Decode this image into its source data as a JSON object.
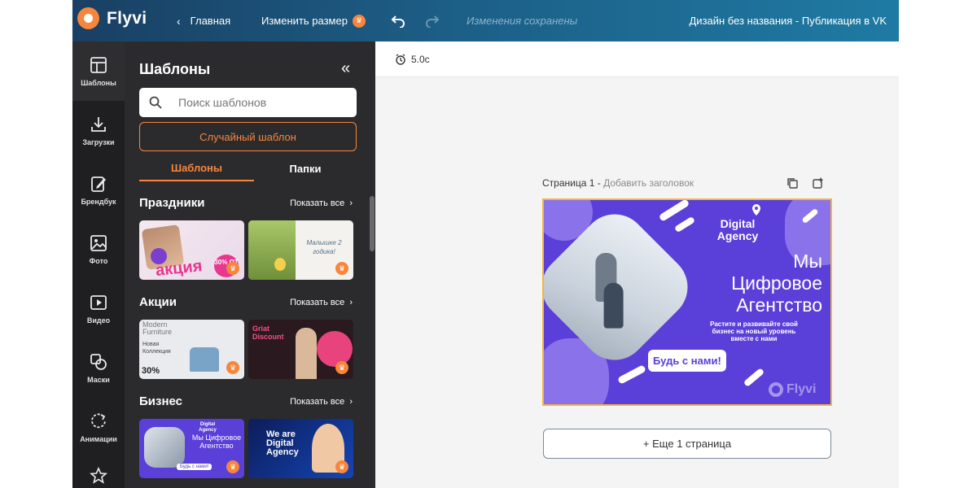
{
  "app": {
    "name": "Flyvi"
  },
  "topbar": {
    "home_label": "Главная",
    "resize_label": "Изменить размер",
    "save_status": "Изменения сохранены",
    "doc_title": "Дизайн без названия - Публикация в VK"
  },
  "rail": {
    "items": [
      {
        "label": "Шаблоны",
        "icon": "layout-icon"
      },
      {
        "label": "Загрузки",
        "icon": "download-icon"
      },
      {
        "label": "Брендбук",
        "icon": "brandbook-icon"
      },
      {
        "label": "Фото",
        "icon": "photo-icon"
      },
      {
        "label": "Видео",
        "icon": "video-icon"
      },
      {
        "label": "Маски",
        "icon": "masks-icon"
      },
      {
        "label": "Анимации",
        "icon": "animation-icon"
      },
      {
        "label": "",
        "icon": "star-icon"
      }
    ]
  },
  "panel": {
    "title": "Шаблоны",
    "search_placeholder": "Поиск шаблонов",
    "random_label": "Случайный шаблон",
    "tabs": [
      "Шаблоны",
      "Папки"
    ],
    "show_all": "Показать все",
    "sections": [
      {
        "title": "Праздники",
        "thumbs": [
          {
            "caption": "акция",
            "badge": "30% ОТ"
          },
          {
            "caption": "Малышке 2 годика!"
          }
        ]
      },
      {
        "title": "Акции",
        "thumbs": [
          {
            "caption": "Modern Furniture",
            "sub": "Новая Коллекция",
            "badge": "30%"
          },
          {
            "caption": "Griat Discount"
          }
        ]
      },
      {
        "title": "Бизнес",
        "thumbs": [
          {
            "caption": "Digital Agency",
            "sub": "Мы Цифровое Агентство",
            "cta": "Будь с нами!"
          },
          {
            "caption": "We are Digital Agency"
          }
        ]
      }
    ]
  },
  "workarea": {
    "duration": "5.0с",
    "page_label": "Страница 1 -",
    "page_title_placeholder": "Добавить заголовок",
    "add_page_label": "+ Еще 1 страница"
  },
  "design": {
    "brand": "Digital Agency",
    "headline": "Мы Цифровое Агентство",
    "body": "Растите и развивайте свой бизнес на новый уровень вместе с нами",
    "cta": "Будь с нами!",
    "watermark": "Flyvi",
    "colors": {
      "background": "#5a3fd8",
      "accent": "#8a73ea",
      "selection": "#f3b53f"
    }
  },
  "colors": {
    "brand_orange": "#f7863c",
    "topbar_start": "#1a3f63",
    "topbar_end": "#1f7aa3",
    "panel_bg": "#2b2b2d",
    "rail_bg": "#1f1f21"
  }
}
